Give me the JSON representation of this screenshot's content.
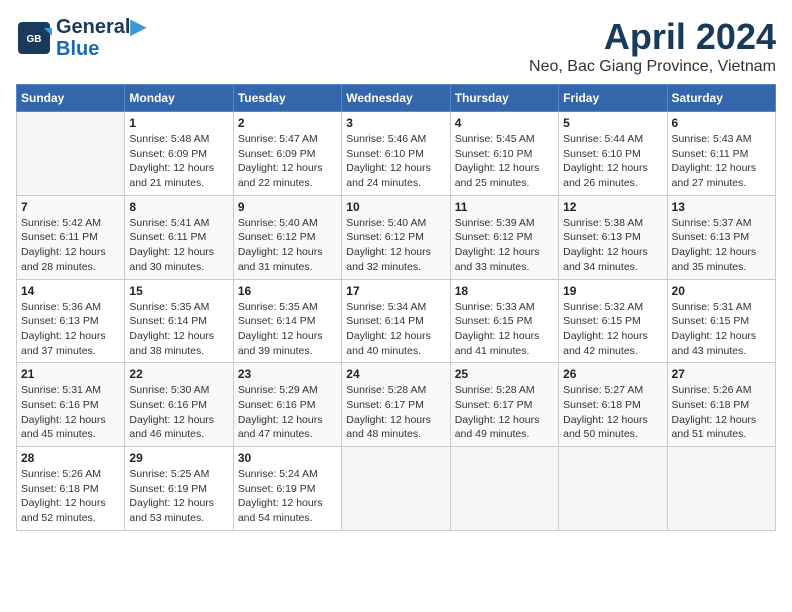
{
  "header": {
    "logo_line1": "General",
    "logo_line2": "Blue",
    "month": "April 2024",
    "location": "Neo, Bac Giang Province, Vietnam"
  },
  "weekdays": [
    "Sunday",
    "Monday",
    "Tuesday",
    "Wednesday",
    "Thursday",
    "Friday",
    "Saturday"
  ],
  "weeks": [
    [
      {
        "day": "",
        "info": ""
      },
      {
        "day": "1",
        "info": "Sunrise: 5:48 AM\nSunset: 6:09 PM\nDaylight: 12 hours\nand 21 minutes."
      },
      {
        "day": "2",
        "info": "Sunrise: 5:47 AM\nSunset: 6:09 PM\nDaylight: 12 hours\nand 22 minutes."
      },
      {
        "day": "3",
        "info": "Sunrise: 5:46 AM\nSunset: 6:10 PM\nDaylight: 12 hours\nand 24 minutes."
      },
      {
        "day": "4",
        "info": "Sunrise: 5:45 AM\nSunset: 6:10 PM\nDaylight: 12 hours\nand 25 minutes."
      },
      {
        "day": "5",
        "info": "Sunrise: 5:44 AM\nSunset: 6:10 PM\nDaylight: 12 hours\nand 26 minutes."
      },
      {
        "day": "6",
        "info": "Sunrise: 5:43 AM\nSunset: 6:11 PM\nDaylight: 12 hours\nand 27 minutes."
      }
    ],
    [
      {
        "day": "7",
        "info": "Sunrise: 5:42 AM\nSunset: 6:11 PM\nDaylight: 12 hours\nand 28 minutes."
      },
      {
        "day": "8",
        "info": "Sunrise: 5:41 AM\nSunset: 6:11 PM\nDaylight: 12 hours\nand 30 minutes."
      },
      {
        "day": "9",
        "info": "Sunrise: 5:40 AM\nSunset: 6:12 PM\nDaylight: 12 hours\nand 31 minutes."
      },
      {
        "day": "10",
        "info": "Sunrise: 5:40 AM\nSunset: 6:12 PM\nDaylight: 12 hours\nand 32 minutes."
      },
      {
        "day": "11",
        "info": "Sunrise: 5:39 AM\nSunset: 6:12 PM\nDaylight: 12 hours\nand 33 minutes."
      },
      {
        "day": "12",
        "info": "Sunrise: 5:38 AM\nSunset: 6:13 PM\nDaylight: 12 hours\nand 34 minutes."
      },
      {
        "day": "13",
        "info": "Sunrise: 5:37 AM\nSunset: 6:13 PM\nDaylight: 12 hours\nand 35 minutes."
      }
    ],
    [
      {
        "day": "14",
        "info": "Sunrise: 5:36 AM\nSunset: 6:13 PM\nDaylight: 12 hours\nand 37 minutes."
      },
      {
        "day": "15",
        "info": "Sunrise: 5:35 AM\nSunset: 6:14 PM\nDaylight: 12 hours\nand 38 minutes."
      },
      {
        "day": "16",
        "info": "Sunrise: 5:35 AM\nSunset: 6:14 PM\nDaylight: 12 hours\nand 39 minutes."
      },
      {
        "day": "17",
        "info": "Sunrise: 5:34 AM\nSunset: 6:14 PM\nDaylight: 12 hours\nand 40 minutes."
      },
      {
        "day": "18",
        "info": "Sunrise: 5:33 AM\nSunset: 6:15 PM\nDaylight: 12 hours\nand 41 minutes."
      },
      {
        "day": "19",
        "info": "Sunrise: 5:32 AM\nSunset: 6:15 PM\nDaylight: 12 hours\nand 42 minutes."
      },
      {
        "day": "20",
        "info": "Sunrise: 5:31 AM\nSunset: 6:15 PM\nDaylight: 12 hours\nand 43 minutes."
      }
    ],
    [
      {
        "day": "21",
        "info": "Sunrise: 5:31 AM\nSunset: 6:16 PM\nDaylight: 12 hours\nand 45 minutes."
      },
      {
        "day": "22",
        "info": "Sunrise: 5:30 AM\nSunset: 6:16 PM\nDaylight: 12 hours\nand 46 minutes."
      },
      {
        "day": "23",
        "info": "Sunrise: 5:29 AM\nSunset: 6:16 PM\nDaylight: 12 hours\nand 47 minutes."
      },
      {
        "day": "24",
        "info": "Sunrise: 5:28 AM\nSunset: 6:17 PM\nDaylight: 12 hours\nand 48 minutes."
      },
      {
        "day": "25",
        "info": "Sunrise: 5:28 AM\nSunset: 6:17 PM\nDaylight: 12 hours\nand 49 minutes."
      },
      {
        "day": "26",
        "info": "Sunrise: 5:27 AM\nSunset: 6:18 PM\nDaylight: 12 hours\nand 50 minutes."
      },
      {
        "day": "27",
        "info": "Sunrise: 5:26 AM\nSunset: 6:18 PM\nDaylight: 12 hours\nand 51 minutes."
      }
    ],
    [
      {
        "day": "28",
        "info": "Sunrise: 5:26 AM\nSunset: 6:18 PM\nDaylight: 12 hours\nand 52 minutes."
      },
      {
        "day": "29",
        "info": "Sunrise: 5:25 AM\nSunset: 6:19 PM\nDaylight: 12 hours\nand 53 minutes."
      },
      {
        "day": "30",
        "info": "Sunrise: 5:24 AM\nSunset: 6:19 PM\nDaylight: 12 hours\nand 54 minutes."
      },
      {
        "day": "",
        "info": ""
      },
      {
        "day": "",
        "info": ""
      },
      {
        "day": "",
        "info": ""
      },
      {
        "day": "",
        "info": ""
      }
    ]
  ]
}
